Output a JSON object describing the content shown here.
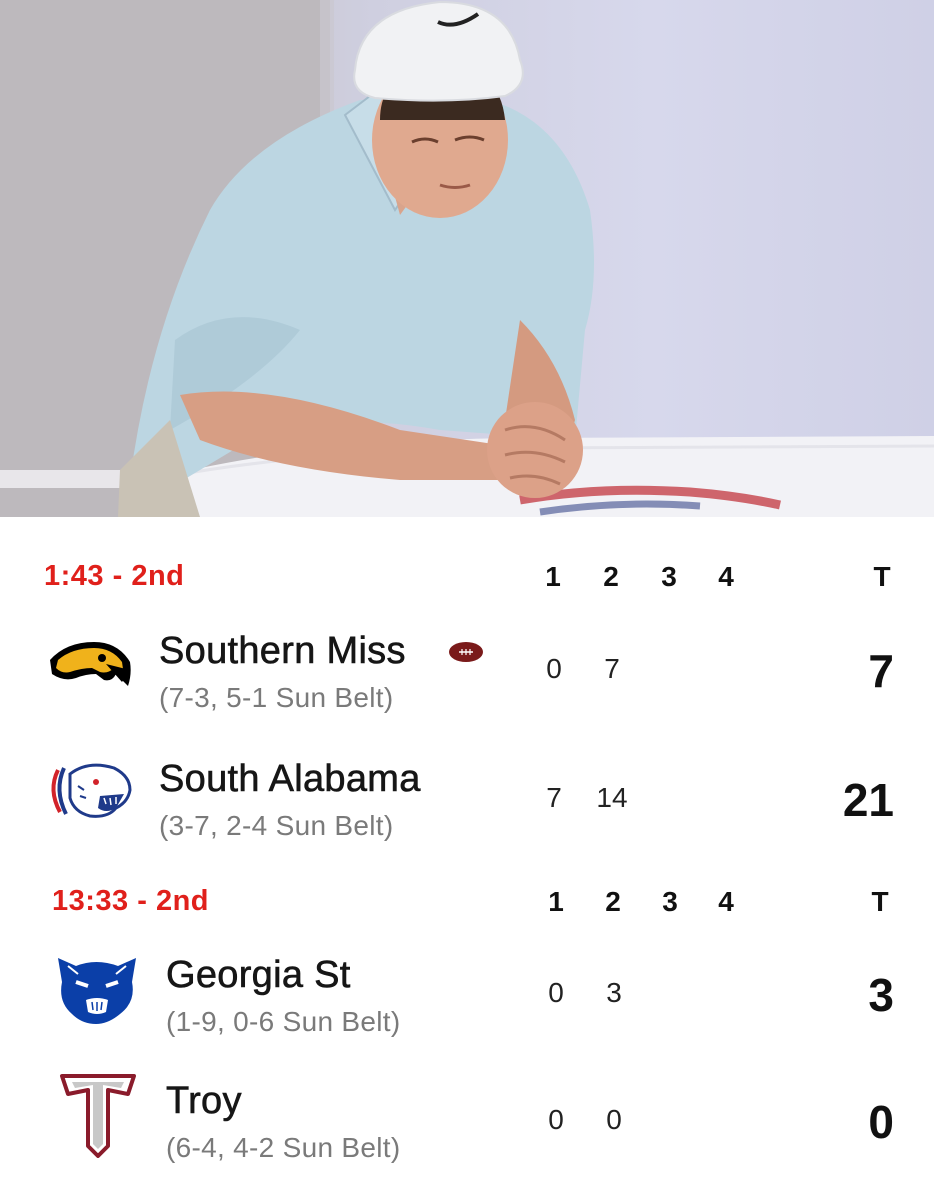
{
  "colors": {
    "status": "#e0201b",
    "team_name": "#161616",
    "record": "#7a7a7a",
    "possession": "#7a1a1a"
  },
  "games": [
    {
      "status": "1:43 - 2nd",
      "quarter_headers": [
        "1",
        "2",
        "3",
        "4"
      ],
      "total_header": "T",
      "teams": [
        {
          "logo_icon": "golden-eagle-logo-icon",
          "name": "Southern Miss",
          "record": "(7-3, 5-1 Sun Belt)",
          "has_possession": true,
          "quarters": [
            "0",
            "7"
          ],
          "total": "7"
        },
        {
          "logo_icon": "jaguar-logo-icon",
          "name": "South Alabama",
          "record": "(3-7, 2-4 Sun Belt)",
          "has_possession": false,
          "quarters": [
            "7",
            "14"
          ],
          "total": "21"
        }
      ]
    },
    {
      "status": "13:33 - 2nd",
      "quarter_headers": [
        "1",
        "2",
        "3",
        "4"
      ],
      "total_header": "T",
      "teams": [
        {
          "logo_icon": "panther-logo-icon",
          "name": "Georgia St",
          "record": "(1-9, 0-6 Sun Belt)",
          "has_possession": false,
          "quarters": [
            "0",
            "3"
          ],
          "total": "3"
        },
        {
          "logo_icon": "trojan-t-logo-icon",
          "name": "Troy",
          "record": "(6-4, 4-2 Sun Belt)",
          "has_possession": false,
          "quarters": [
            "0",
            "0"
          ],
          "total": "0"
        }
      ]
    }
  ]
}
